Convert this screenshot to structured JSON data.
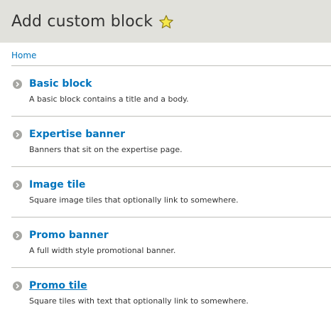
{
  "header": {
    "title": "Add custom block",
    "star_icon": "star-icon",
    "background": "#e1e1dc"
  },
  "breadcrumb": {
    "items": [
      {
        "label": "Home"
      }
    ]
  },
  "blocks": [
    {
      "name": "Basic block",
      "description": "A basic block contains a title and a body."
    },
    {
      "name": "Expertise banner",
      "description": "Banners that sit on the expertise page."
    },
    {
      "name": "Image tile",
      "description": "Square image tiles that optionally link to somewhere."
    },
    {
      "name": "Promo banner",
      "description": "A full width style promotional banner."
    },
    {
      "name": "Promo tile",
      "description": "Square tiles with text that optionally link to somewhere."
    }
  ],
  "colors": {
    "link": "#0074bd",
    "text": "#333333",
    "divider": "#bfbfba",
    "bullet": "#a6a6a2"
  }
}
